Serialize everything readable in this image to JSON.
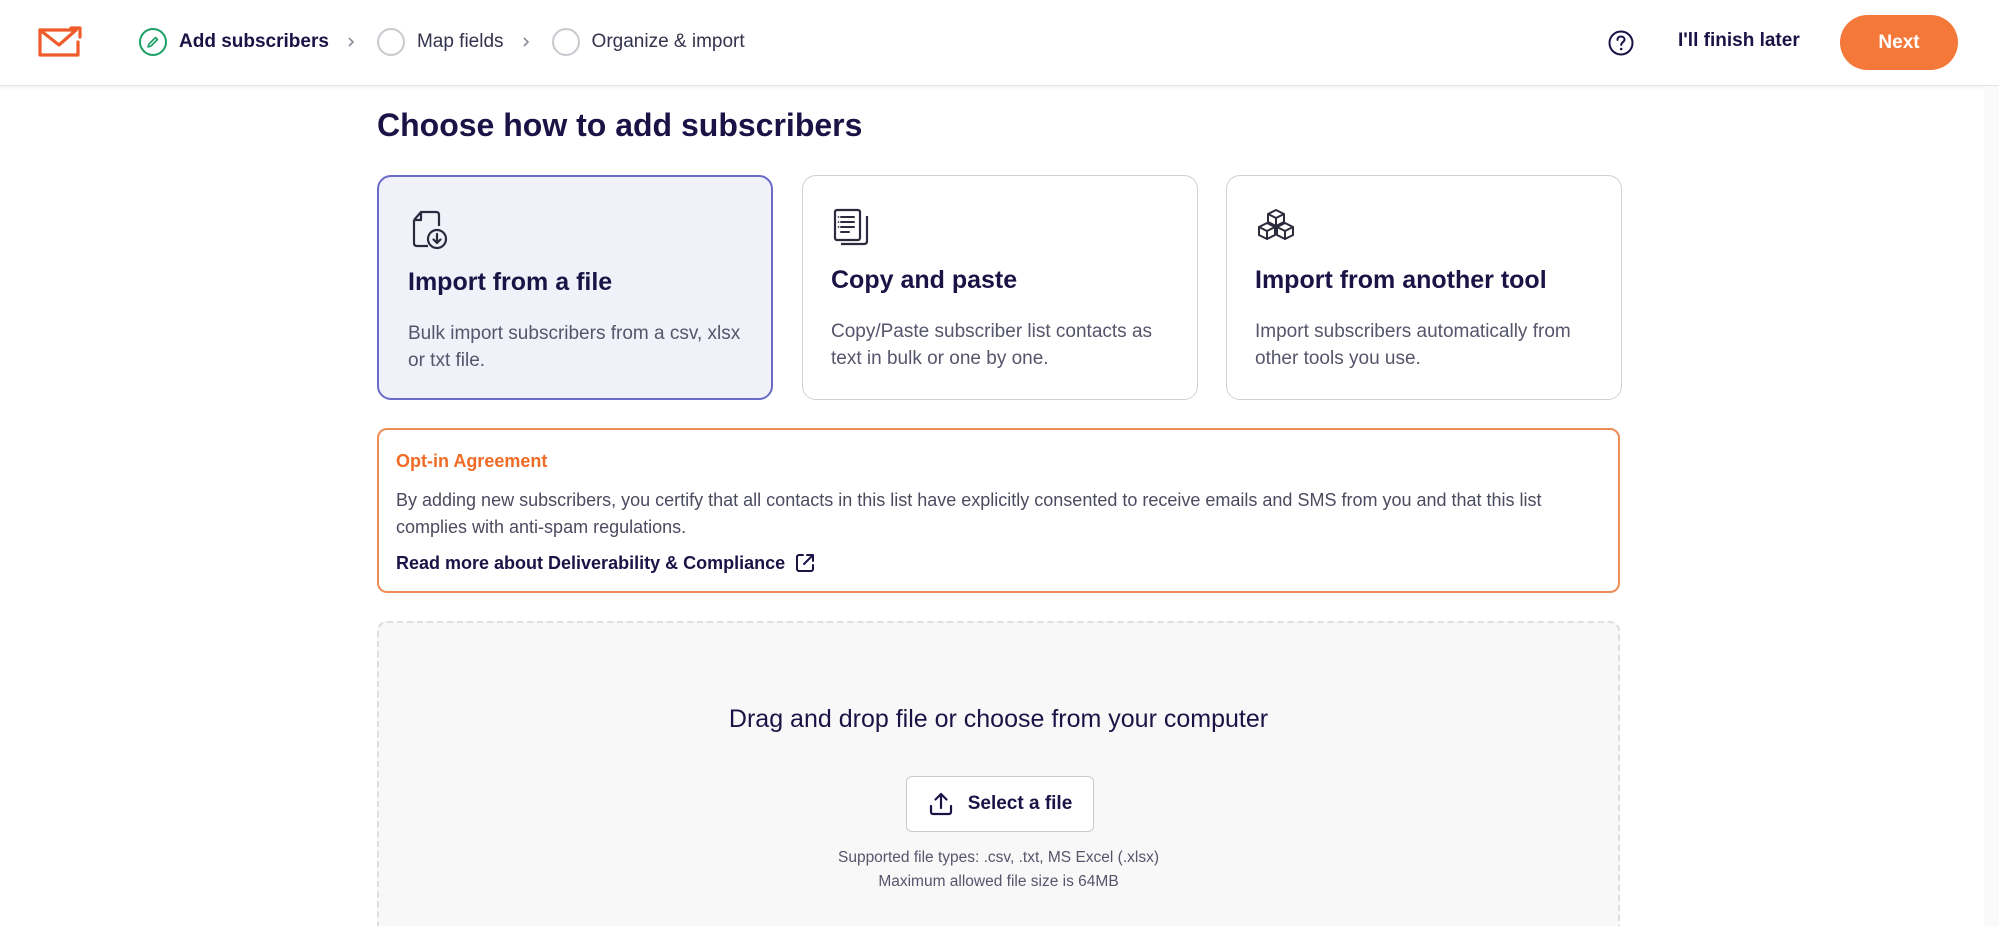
{
  "header": {
    "steps": [
      {
        "label": "Add subscribers",
        "state": "active"
      },
      {
        "label": "Map fields",
        "state": "pending"
      },
      {
        "label": "Organize & import",
        "state": "pending"
      }
    ],
    "finish_later": "I'll finish later",
    "next": "Next",
    "icons": {
      "logo": "mail-logo-icon",
      "help": "help-circle-icon",
      "step_active": "pencil-icon",
      "separator": "chevron-right-icon"
    }
  },
  "main": {
    "title": "Choose how to add subscribers",
    "cards": [
      {
        "title": "Import from a file",
        "description": "Bulk import subscribers from a csv, xlsx or txt file.",
        "selected": true,
        "icon": "file-import-icon"
      },
      {
        "title": "Copy and paste",
        "description": "Copy/Paste subscriber list contacts as text in bulk or one by one.",
        "selected": false,
        "icon": "copy-paste-icon"
      },
      {
        "title": "Import from another tool",
        "description": "Import subscribers automatically from other tools you use.",
        "selected": false,
        "icon": "integrations-cubes-icon"
      }
    ],
    "optin": {
      "title": "Opt-in Agreement",
      "text": "By adding new subscribers, you certify that all contacts in this list have explicitly consented to receive emails and SMS from you and that this list complies with anti-spam regulations.",
      "link": "Read more about Deliverability & Compliance",
      "link_icon": "external-link-icon"
    },
    "dropzone": {
      "title": "Drag and drop file or choose from your computer",
      "button": "Select a file",
      "button_icon": "upload-icon",
      "supported": "Supported file types: .csv, .txt, MS Excel (.xlsx)",
      "max_size": "Maximum allowed file size is 64MB"
    }
  },
  "colors": {
    "accent": "#f4783a",
    "selected_border": "#6b6bc9",
    "selected_bg": "#f1f1fa",
    "success": "#1aa163",
    "navy": "#1a1446"
  }
}
